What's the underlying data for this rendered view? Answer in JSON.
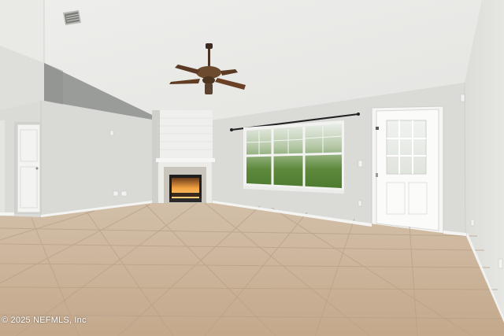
{
  "watermark": {
    "text": "© 2025 NEFMLS, Inc"
  }
}
